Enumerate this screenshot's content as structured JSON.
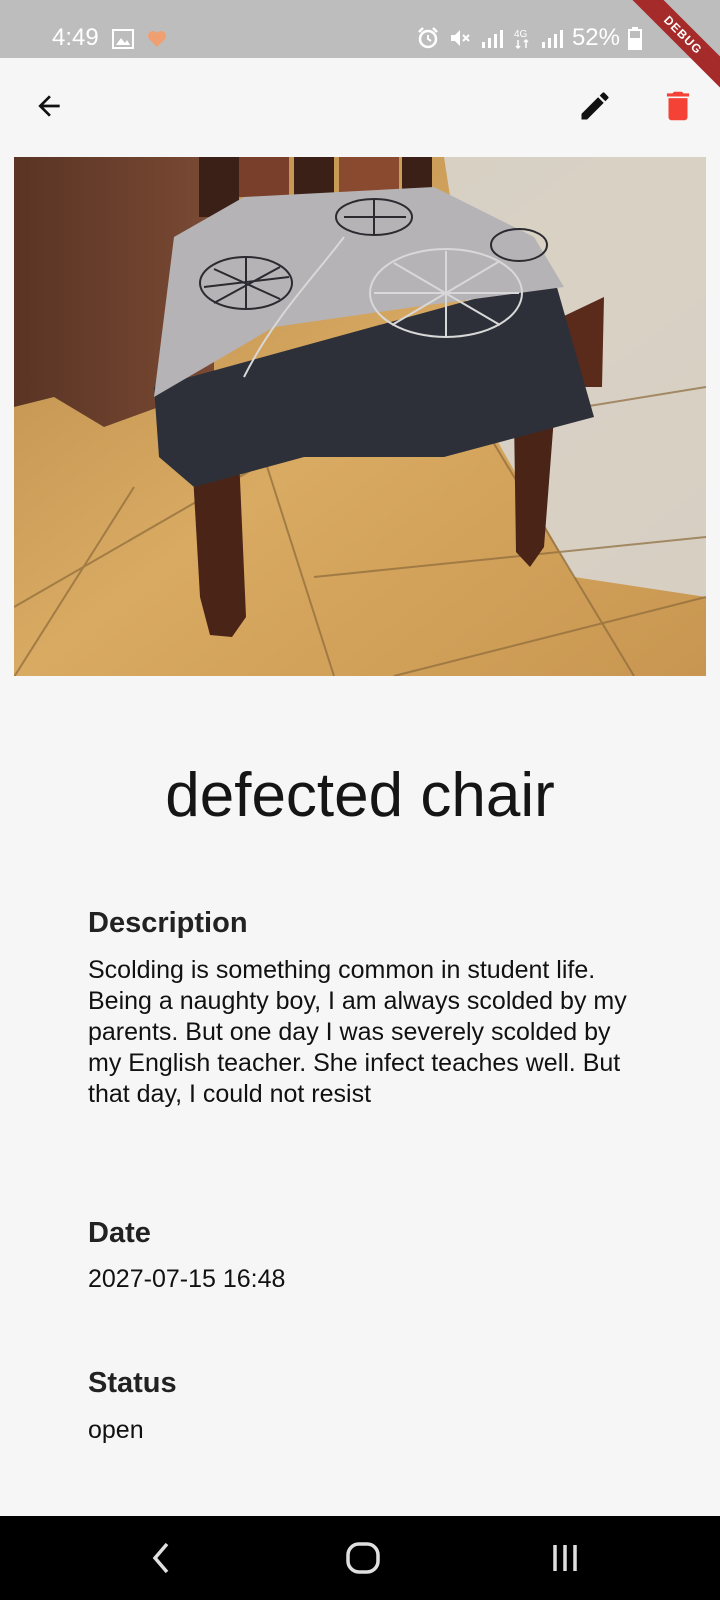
{
  "status_bar": {
    "time": "4:49",
    "battery": "52%",
    "icons": [
      "image-icon",
      "heart-icon",
      "alarm-icon",
      "mute-icon",
      "signal-icon",
      "4g-icon",
      "signal-icon",
      "battery-icon"
    ]
  },
  "debug_banner": "DEBUG",
  "app_bar": {
    "back_icon": "arrow-left-icon",
    "edit_icon": "pencil-icon",
    "delete_icon": "trash-icon",
    "delete_color": "#f44336"
  },
  "item": {
    "title": "defected chair",
    "description_label": "Description",
    "description": "Scolding is something common in student life. Being a naughty boy, I am always scolded by my parents. But one day I was severely scolded by my English teacher. She infect teaches well. But that day, I could not resist",
    "date_label": "Date",
    "date": "2027-07-15 16:48",
    "status_label": "Status",
    "status": "open"
  },
  "nav_bar": {
    "icons": [
      "back-nav-icon",
      "home-nav-icon",
      "recents-nav-icon"
    ]
  }
}
